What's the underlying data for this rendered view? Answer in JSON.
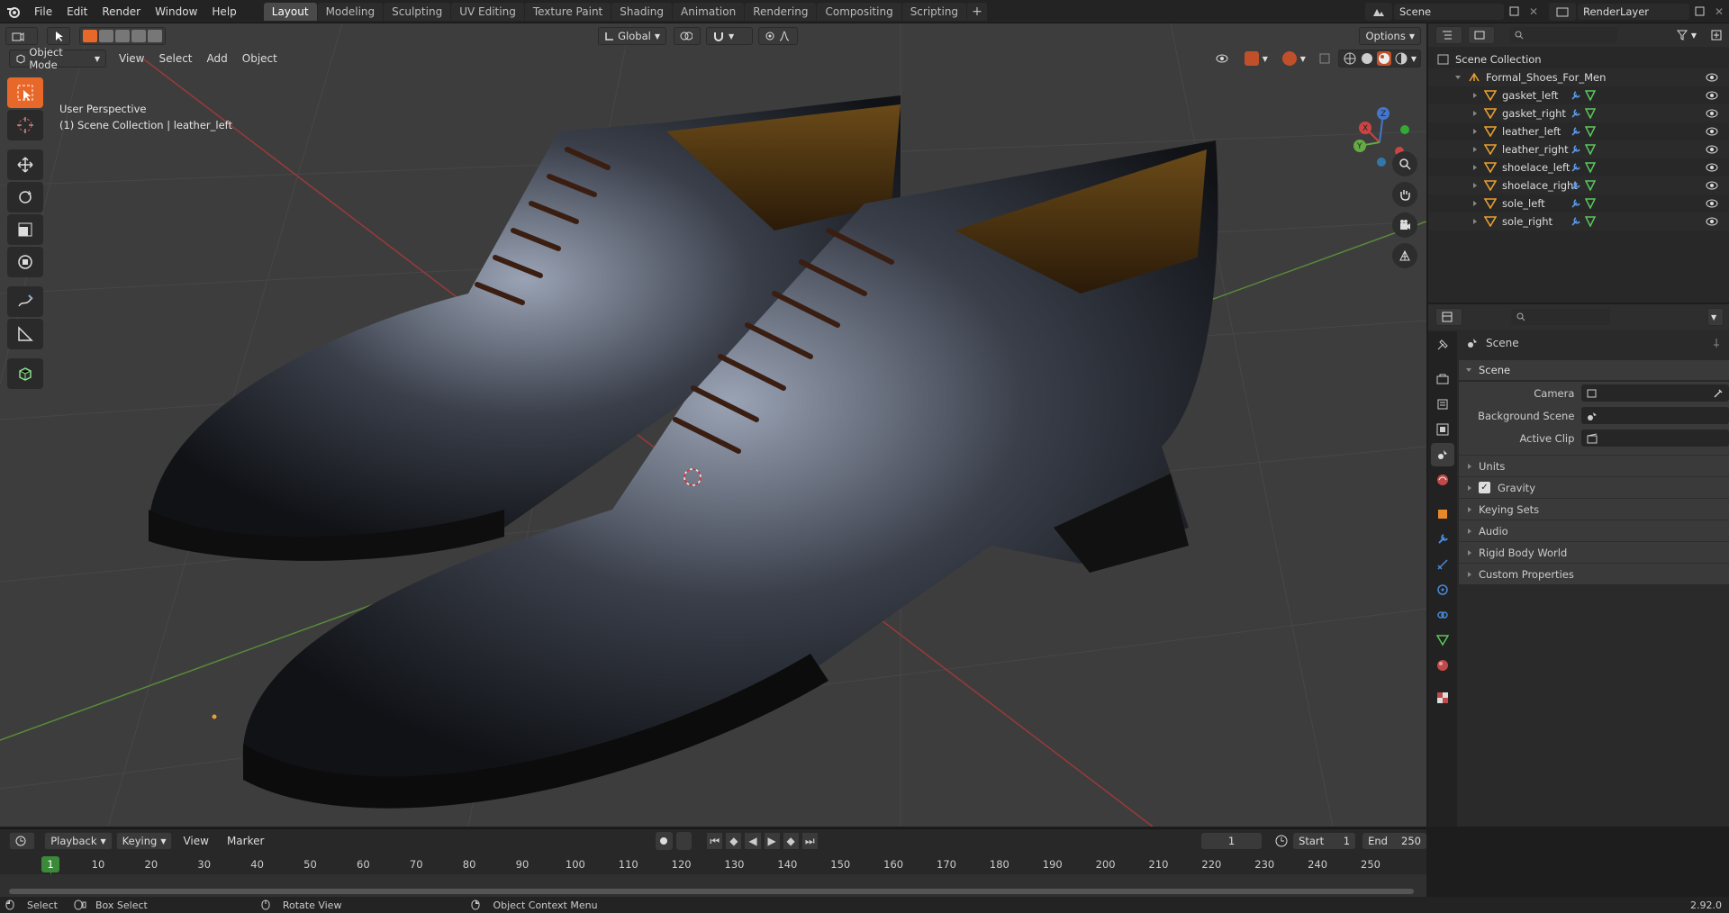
{
  "app": {
    "name": "Blender",
    "version": "2.92.0"
  },
  "menu": [
    "File",
    "Edit",
    "Render",
    "Window",
    "Help"
  ],
  "workspaces": {
    "active": "Layout",
    "tabs": [
      "Layout",
      "Modeling",
      "Sculpting",
      "UV Editing",
      "Texture Paint",
      "Shading",
      "Animation",
      "Rendering",
      "Compositing",
      "Scripting"
    ]
  },
  "scene_field": "Scene",
  "render_layer_field": "RenderLayer",
  "viewport": {
    "mode": "Object Mode",
    "menus": [
      "View",
      "Select",
      "Add",
      "Object"
    ],
    "transform_orientation": "Global",
    "options_label": "Options",
    "perspective": "User Perspective",
    "collection_info": "(1) Scene Collection | leather_left"
  },
  "outliner": {
    "root": "Scene Collection",
    "collection": "Formal_Shoes_For_Men",
    "objects": [
      "gasket_left",
      "gasket_right",
      "leather_left",
      "leather_right",
      "shoelace_left",
      "shoelace_right",
      "sole_left",
      "sole_right"
    ]
  },
  "properties": {
    "context": "Scene",
    "panel": "Scene",
    "fields": [
      {
        "label": "Camera",
        "value": ""
      },
      {
        "label": "Background Scene",
        "value": ""
      },
      {
        "label": "Active Clip",
        "value": ""
      }
    ],
    "subpanels": [
      "Units",
      "Gravity",
      "Keying Sets",
      "Audio",
      "Rigid Body World",
      "Custom Properties"
    ],
    "gravity_checked": true
  },
  "timeline": {
    "menus": [
      "Playback",
      "Keying",
      "View",
      "Marker"
    ],
    "current_frame": "1",
    "start_label": "Start",
    "start": "1",
    "end_label": "End",
    "end": "250",
    "ticks": [
      "10",
      "20",
      "30",
      "40",
      "50",
      "60",
      "70",
      "80",
      "90",
      "100",
      "110",
      "120",
      "130",
      "140",
      "150",
      "160",
      "170",
      "180",
      "190",
      "200",
      "210",
      "220",
      "230",
      "240",
      "250"
    ]
  },
  "statusbar": {
    "select": "Select",
    "box_select": "Box Select",
    "rotate": "Rotate View",
    "context_menu": "Object Context Menu"
  }
}
